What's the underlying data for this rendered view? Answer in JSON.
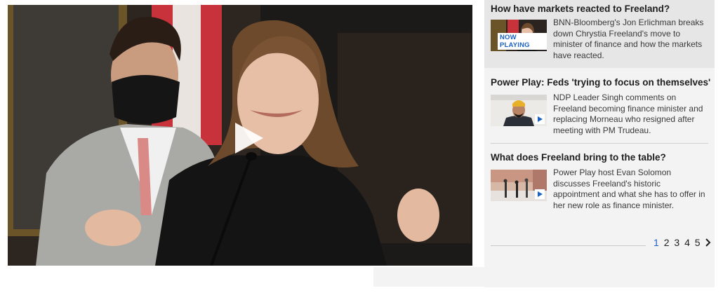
{
  "player": {
    "play_icon": "play-icon",
    "scene_colors": {
      "wall": "#3b2f26",
      "frame": "#8a6a2a",
      "flag_red": "#c8323a",
      "suit_left": "#a9a9a6",
      "jacket": "#141414",
      "hair": "#6e4a2c",
      "skin": "#e6bfa6"
    }
  },
  "playlist": {
    "items": [
      {
        "title": "How have markets reacted to Freeland?",
        "description": "BNN-Bloomberg's Jon Erlichman breaks down Chrystia Freeland's move to minister of finance and how the markets have reacted.",
        "badge": "NOW PLAYING",
        "active": true
      },
      {
        "title": "Power Play: Feds 'trying to focus on themselves'",
        "description": "NDP Leader Singh comments on Freeland becoming finance minister and replacing Morneau who resigned after meeting with PM Trudeau.",
        "active": false
      },
      {
        "title": "What does Freeland bring to the table?",
        "description": "Power Play host Evan Solomon discusses Freeland's historic appointment and what she has to offer in her new role as finance minister.",
        "active": false
      }
    ]
  },
  "pagination": {
    "pages": [
      "1",
      "2",
      "3",
      "4",
      "5"
    ],
    "current": "1",
    "next_icon": "chevron-right-icon"
  },
  "colors": {
    "accent": "#1c62c2",
    "rail_bg": "#f3f3f3",
    "active_bg": "#e6e6e6"
  }
}
